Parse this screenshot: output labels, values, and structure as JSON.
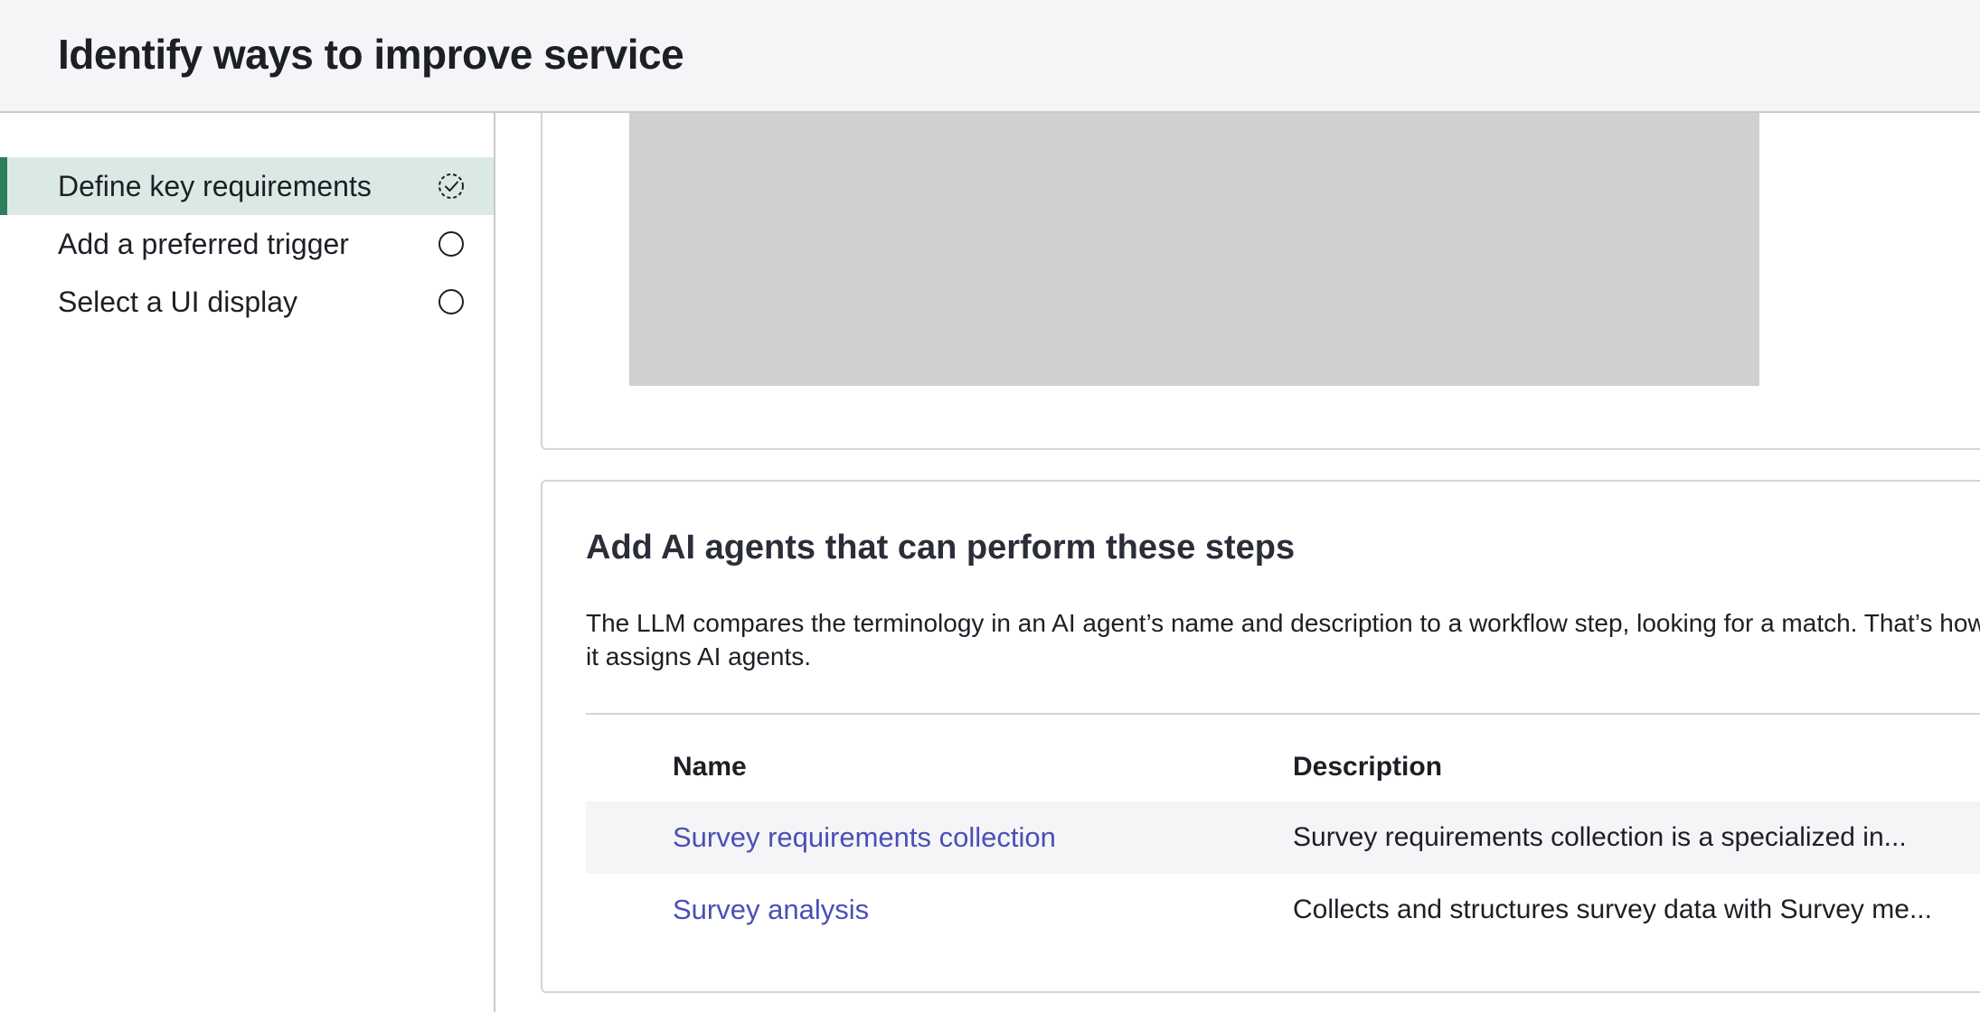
{
  "header": {
    "title": "Identify ways to improve service"
  },
  "sidebar": {
    "items": [
      {
        "label": "Define key requirements",
        "status": "in-progress",
        "icon": "dashed-check-circle-icon"
      },
      {
        "label": "Add a preferred trigger",
        "status": "not-started",
        "icon": "empty-circle-icon"
      },
      {
        "label": "Select a UI display",
        "status": "not-started",
        "icon": "empty-circle-icon"
      }
    ]
  },
  "agents_section": {
    "title": "Add AI agents that can perform these steps",
    "description": "The LLM compares the terminology in an AI agent’s name and description to a workflow step, looking for a match. That’s how it assigns AI agents.",
    "columns": [
      "Name",
      "Description"
    ],
    "rows": [
      {
        "name": "Survey requirements collection",
        "description": "Survey requirements collection is a specialized in..."
      },
      {
        "name": "Survey analysis",
        "description": "Collects and structures survey data with Survey me..."
      }
    ]
  },
  "colors": {
    "active_bar": "#2e7d5b",
    "active_bg": "#dbe9e4",
    "link": "#4a4fb8",
    "placeholder": "#d0d0d0"
  }
}
